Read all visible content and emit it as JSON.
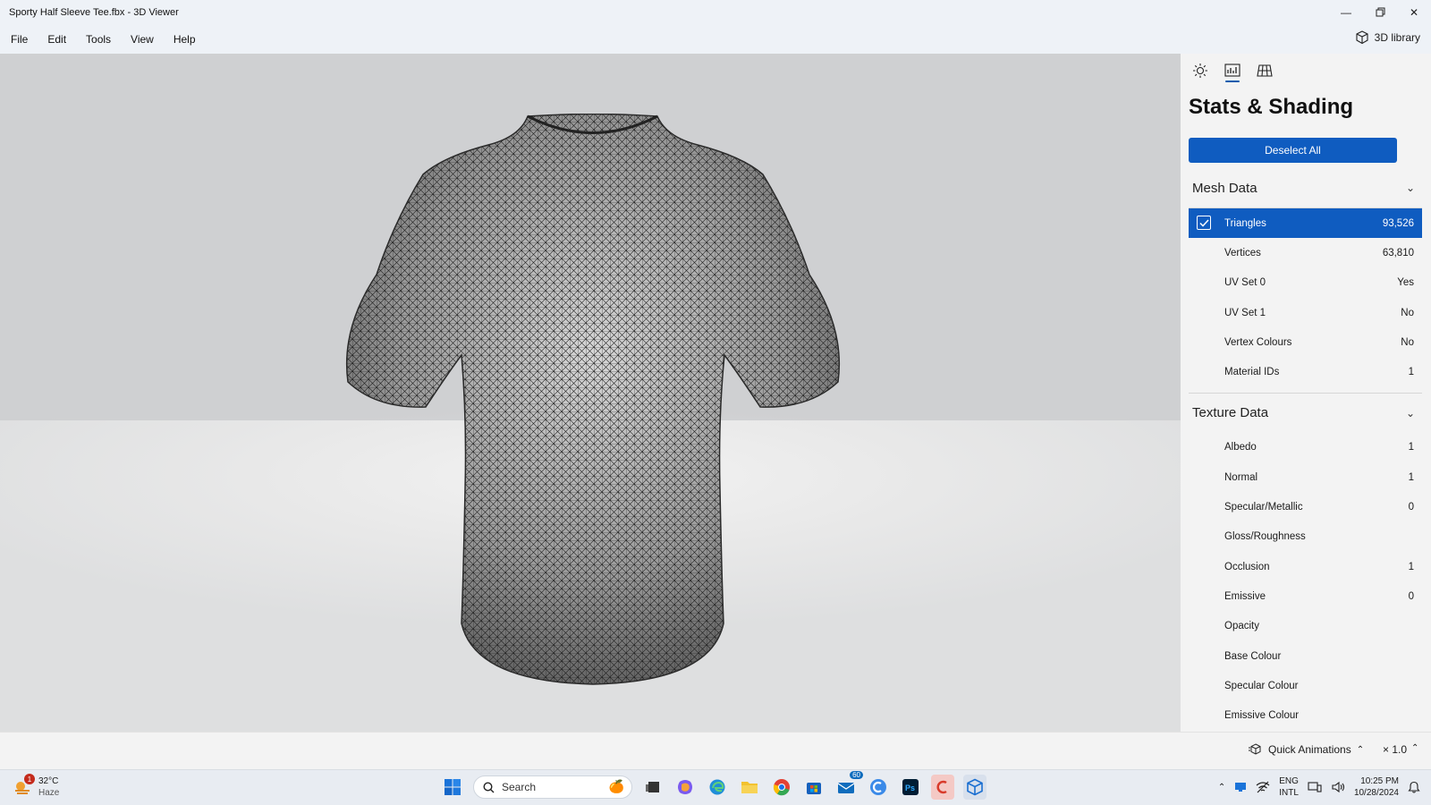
{
  "window": {
    "title": "Sporty Half Sleeve Tee.fbx - 3D Viewer",
    "controls": [
      "minimize",
      "restore",
      "close"
    ]
  },
  "menubar": {
    "items": [
      "File",
      "Edit",
      "Tools",
      "View",
      "Help"
    ],
    "library_label": "3D library"
  },
  "panel": {
    "tabs": [
      "lighting-icon",
      "stats-icon",
      "grid-icon"
    ],
    "title": "Stats & Shading",
    "deselect_label": "Deselect All",
    "mesh_section": {
      "label": "Mesh Data",
      "rows": [
        {
          "label": "Triangles",
          "value": "93,526",
          "selected": true
        },
        {
          "label": "Vertices",
          "value": "63,810"
        },
        {
          "label": "UV Set 0",
          "value": "Yes"
        },
        {
          "label": "UV Set 1",
          "value": "No"
        },
        {
          "label": "Vertex Colours",
          "value": "No"
        },
        {
          "label": "Material IDs",
          "value": "1"
        }
      ]
    },
    "texture_section": {
      "label": "Texture Data",
      "rows": [
        {
          "label": "Albedo",
          "value": "1"
        },
        {
          "label": "Normal",
          "value": "1"
        },
        {
          "label": "Specular/Metallic",
          "value": "0"
        },
        {
          "label": "Gloss/Roughness",
          "value": ""
        },
        {
          "label": "Occlusion",
          "value": "1"
        },
        {
          "label": "Emissive",
          "value": "0"
        },
        {
          "label": "Opacity",
          "value": ""
        },
        {
          "label": "Base Colour",
          "value": ""
        },
        {
          "label": "Specular Colour",
          "value": ""
        },
        {
          "label": "Emissive Colour",
          "value": ""
        }
      ]
    }
  },
  "bottom": {
    "quick_animations": "Quick Animations",
    "speed": "× 1.0"
  },
  "taskbar": {
    "weather_temp": "32°C",
    "weather_desc": "Haze",
    "weather_badge": "1",
    "search_placeholder": "Search",
    "mail_badge": "60",
    "lang_line1": "ENG",
    "lang_line2": "INTL",
    "time": "10:25 PM",
    "date": "10/28/2024"
  },
  "colors": {
    "accent": "#0f5cc0",
    "titlebar": "#eef2f7",
    "panel_bg": "#f3f3f3"
  }
}
